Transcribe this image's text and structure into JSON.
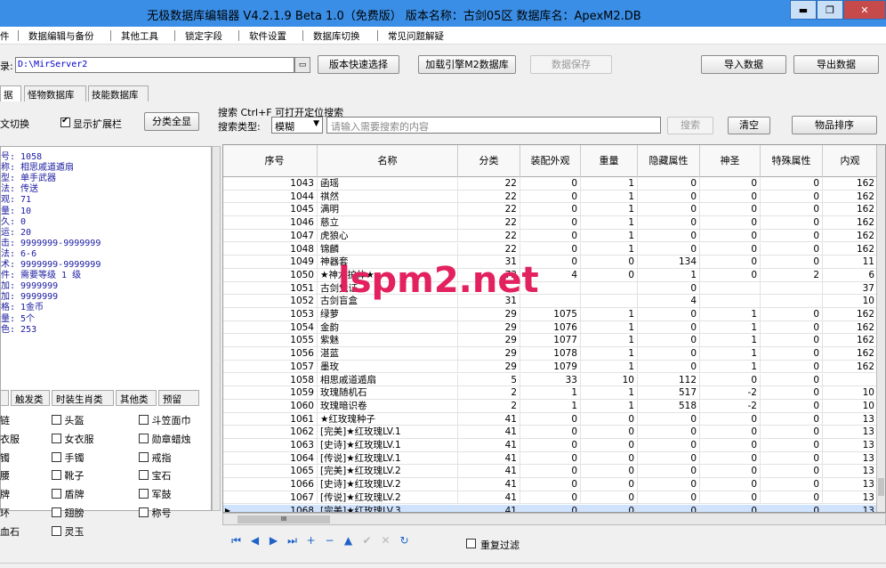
{
  "window": {
    "title": "无极数据库编辑器 V4.2.1.9   Beta 1.0（免费版）   版本名称：古剑05区   数据库名：ApexM2.DB",
    "min": "▬",
    "max": "❐",
    "close": "✕"
  },
  "menu": [
    "件",
    "数据编辑与备份",
    "其他工具",
    "锁定字段",
    "软件设置",
    "数据库切换",
    "常见问题解疑"
  ],
  "toolbar": {
    "path_label": "录:",
    "path_value": "D:\\MirServer2",
    "quick_select": "版本快速选择",
    "load_engine": "加载引擎M2数据库",
    "save_data": "数据保存",
    "import": "导入数据",
    "export": "导出数据"
  },
  "tabs": [
    "据库",
    "怪物数据库",
    "技能数据库"
  ],
  "left": {
    "text_switch": "文切换",
    "show_ext": "显示扩展栏",
    "category_all": "分类全显",
    "info_lines": [
      "号: 1058",
      "称: 相思戚道遁扇",
      "型: 单手武器",
      "法: 传送",
      "观: 71",
      "量: 10",
      "久: 0",
      "运: 20",
      "击: 9999999-9999999",
      "法: 6-6",
      "术: 9999999-9999999",
      "件: 需要等级 1 级",
      "加: 9999999",
      "加: 9999999",
      "格: 1金币",
      "量: 5个",
      "色: 253"
    ],
    "cat_tabs": [
      "触发类",
      "时装生肖类",
      "其他类",
      "预留"
    ],
    "cats": [
      [
        "链",
        "头盔",
        "斗笠面巾"
      ],
      [
        "衣服",
        "女衣服",
        "勋章蜡烛"
      ],
      [
        "镯",
        "手镯",
        "戒指"
      ],
      [
        "腰",
        "靴子",
        "宝石"
      ],
      [
        "牌",
        "盾牌",
        "军鼓"
      ],
      [
        "环",
        "翅膀",
        "称号"
      ],
      [
        "血石",
        "灵玉",
        ""
      ]
    ]
  },
  "search": {
    "label": "搜索   Ctrl+F 可打开定位搜索",
    "type_label": "搜索类型:",
    "type_value": "模糊",
    "placeholder": "请输入需要搜索的内容",
    "search_btn": "搜索",
    "clear_btn": "清空",
    "sort_btn": "物品排序"
  },
  "grid": {
    "headers": [
      "序号",
      "名称",
      "分类",
      "装配外观",
      "重量",
      "隐藏属性",
      "神圣",
      "特殊属性",
      "内观"
    ],
    "rows": [
      [
        "1043",
        "函瑶",
        "22",
        "0",
        "1",
        "0",
        "0",
        "0",
        "162"
      ],
      [
        "1044",
        "祺然",
        "22",
        "0",
        "1",
        "0",
        "0",
        "0",
        "162"
      ],
      [
        "1045",
        "满明",
        "22",
        "0",
        "1",
        "0",
        "0",
        "0",
        "162"
      ],
      [
        "1046",
        "慈立",
        "22",
        "0",
        "1",
        "0",
        "0",
        "0",
        "162"
      ],
      [
        "1047",
        "虎狼心",
        "22",
        "0",
        "1",
        "0",
        "0",
        "0",
        "162"
      ],
      [
        "1048",
        "锦麟",
        "22",
        "0",
        "1",
        "0",
        "0",
        "0",
        "162"
      ],
      [
        "1049",
        "神器套",
        "31",
        "0",
        "0",
        "134",
        "0",
        "0",
        "11"
      ],
      [
        "1050",
        "★神龙护体★",
        "73",
        "4",
        "0",
        "1",
        "0",
        "2",
        "6"
      ],
      [
        "1051",
        "古剑凭证",
        "",
        "",
        "",
        "0",
        "",
        "",
        "37"
      ],
      [
        "1052",
        "古剑盲盒",
        "31",
        "",
        "",
        "4",
        "",
        "",
        "10"
      ],
      [
        "1053",
        "绿萝",
        "29",
        "1075",
        "1",
        "0",
        "1",
        "0",
        "162"
      ],
      [
        "1054",
        "金韵",
        "29",
        "1076",
        "1",
        "0",
        "1",
        "0",
        "162"
      ],
      [
        "1055",
        "紫魅",
        "29",
        "1077",
        "1",
        "0",
        "1",
        "0",
        "162"
      ],
      [
        "1056",
        "湛蓝",
        "29",
        "1078",
        "1",
        "0",
        "1",
        "0",
        "162"
      ],
      [
        "1057",
        "墨玫",
        "29",
        "1079",
        "1",
        "0",
        "1",
        "0",
        "162"
      ],
      [
        "1058",
        "相思戚道遁扇",
        "5",
        "33",
        "10",
        "112",
        "0",
        "0",
        ""
      ],
      [
        "1059",
        "玫瑰随机石",
        "2",
        "1",
        "1",
        "517",
        "-2",
        "0",
        "10"
      ],
      [
        "1060",
        "玫瑰暗识卷",
        "2",
        "1",
        "1",
        "518",
        "-2",
        "0",
        "10"
      ],
      [
        "1061",
        "★红玫瑰种子",
        "41",
        "0",
        "0",
        "0",
        "0",
        "0",
        "13"
      ],
      [
        "1062",
        "[完美]★红玫瑰LV.1",
        "41",
        "0",
        "0",
        "0",
        "0",
        "0",
        "13"
      ],
      [
        "1063",
        "[史诗]★红玫瑰LV.1",
        "41",
        "0",
        "0",
        "0",
        "0",
        "0",
        "13"
      ],
      [
        "1064",
        "[传说]★红玫瑰LV.1",
        "41",
        "0",
        "0",
        "0",
        "0",
        "0",
        "13"
      ],
      [
        "1065",
        "[完美]★红玫瑰LV.2",
        "41",
        "0",
        "0",
        "0",
        "0",
        "0",
        "13"
      ],
      [
        "1066",
        "[史诗]★红玫瑰LV.2",
        "41",
        "0",
        "0",
        "0",
        "0",
        "0",
        "13"
      ],
      [
        "1067",
        "[传说]★红玫瑰LV.2",
        "41",
        "0",
        "0",
        "0",
        "0",
        "0",
        "13"
      ],
      [
        "1068",
        "[完美]★红玫瑰LV.3",
        "41",
        "0",
        "0",
        "0",
        "0",
        "0",
        "13"
      ]
    ],
    "scroll_label": "III"
  },
  "nav": [
    "⏮",
    "◀",
    "▶",
    "⏭",
    "+",
    "−",
    "▲",
    "✔",
    "✕",
    "↻"
  ],
  "dup_filter": "重复过滤",
  "watermark": "lspm2.net"
}
